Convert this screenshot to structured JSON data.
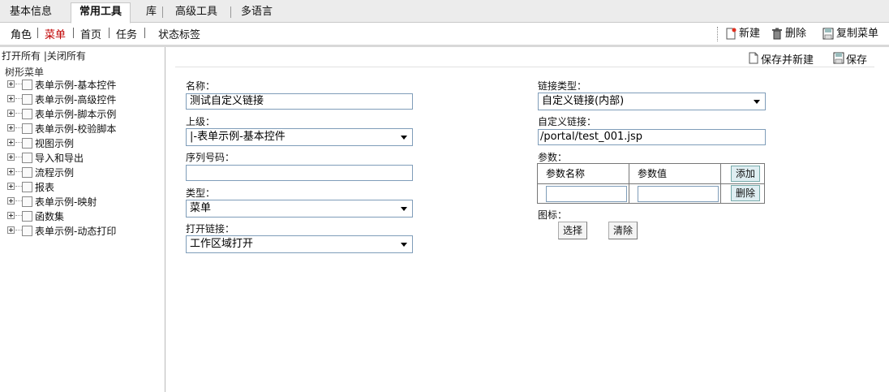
{
  "top_tabs": [
    "基本信息",
    "常用工具",
    "库",
    "高级工具",
    "多语言"
  ],
  "active_tab": "常用工具",
  "sub_nav": [
    "角色",
    "菜单",
    "首页",
    "任务",
    "状态标签"
  ],
  "active_sub": "菜单",
  "toolbar": {
    "new": "新建",
    "delete": "删除",
    "copy_menu": "复制菜单"
  },
  "tree": {
    "open_all": "打开所有",
    "close_all": "关闭所有",
    "root": "树形菜单",
    "items": [
      "表单示例-基本控件",
      "表单示例-高级控件",
      "表单示例-脚本示例",
      "表单示例-校验脚本",
      "视图示例",
      "导入和导出",
      "流程示例",
      "报表",
      "表单示例-映射",
      "函数集",
      "表单示例-动态打印"
    ]
  },
  "actions": {
    "save_and_new": "保存并新建",
    "save": "保存"
  },
  "form": {
    "name_label": "名称：",
    "name_value": "测试自定义链接",
    "parent_label": "上级：",
    "parent_value": "|-表单示例-基本控件",
    "order_label": "序列号码：",
    "order_value": "",
    "type_label": "类型：",
    "type_value": "菜单",
    "open_label": "打开链接：",
    "open_value": "工作区域打开",
    "link_type_label": "链接类型：",
    "link_type_value": "自定义链接(内部)",
    "custom_link_label": "自定义链接：",
    "custom_link_value": "/portal/test_001.jsp",
    "params_label": "参数：",
    "param_name_header": "参数名称",
    "param_value_header": "参数值",
    "add_button": "添加",
    "remove_button": "删除",
    "icon_label": "图标：",
    "select_button": "选择",
    "clear_button": "清除"
  },
  "colors": {
    "active_sub": "#c00000",
    "border_input": "#7f9db9"
  }
}
